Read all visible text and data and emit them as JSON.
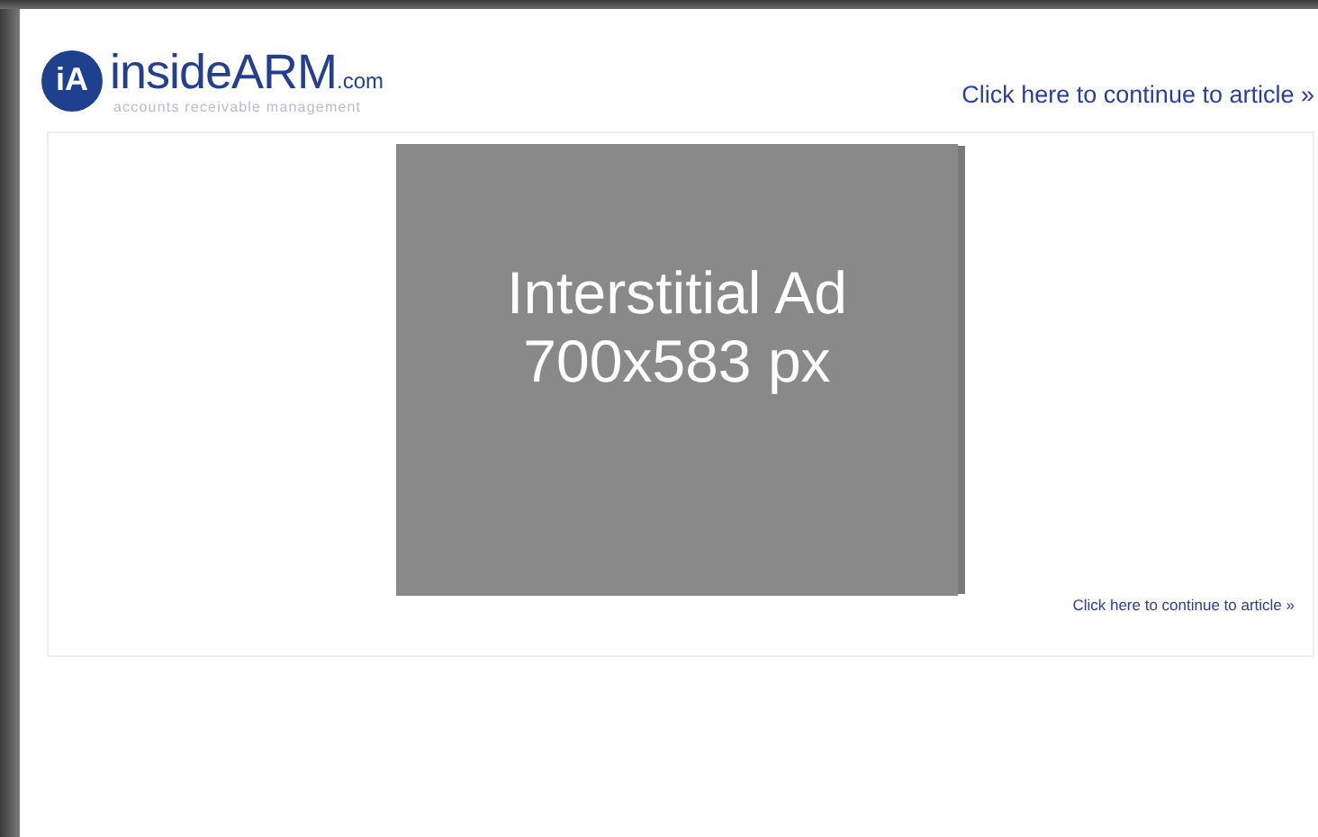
{
  "header": {
    "logo": {
      "badge": "iA",
      "name": "insideARM",
      "suffix": ".com",
      "tagline": "accounts receivable management"
    },
    "continue_link": "Click here to continue to article »"
  },
  "ad": {
    "line1": "Interstitial Ad",
    "line2": "700x583 px"
  },
  "footer_link": "Click here to continue to article »"
}
